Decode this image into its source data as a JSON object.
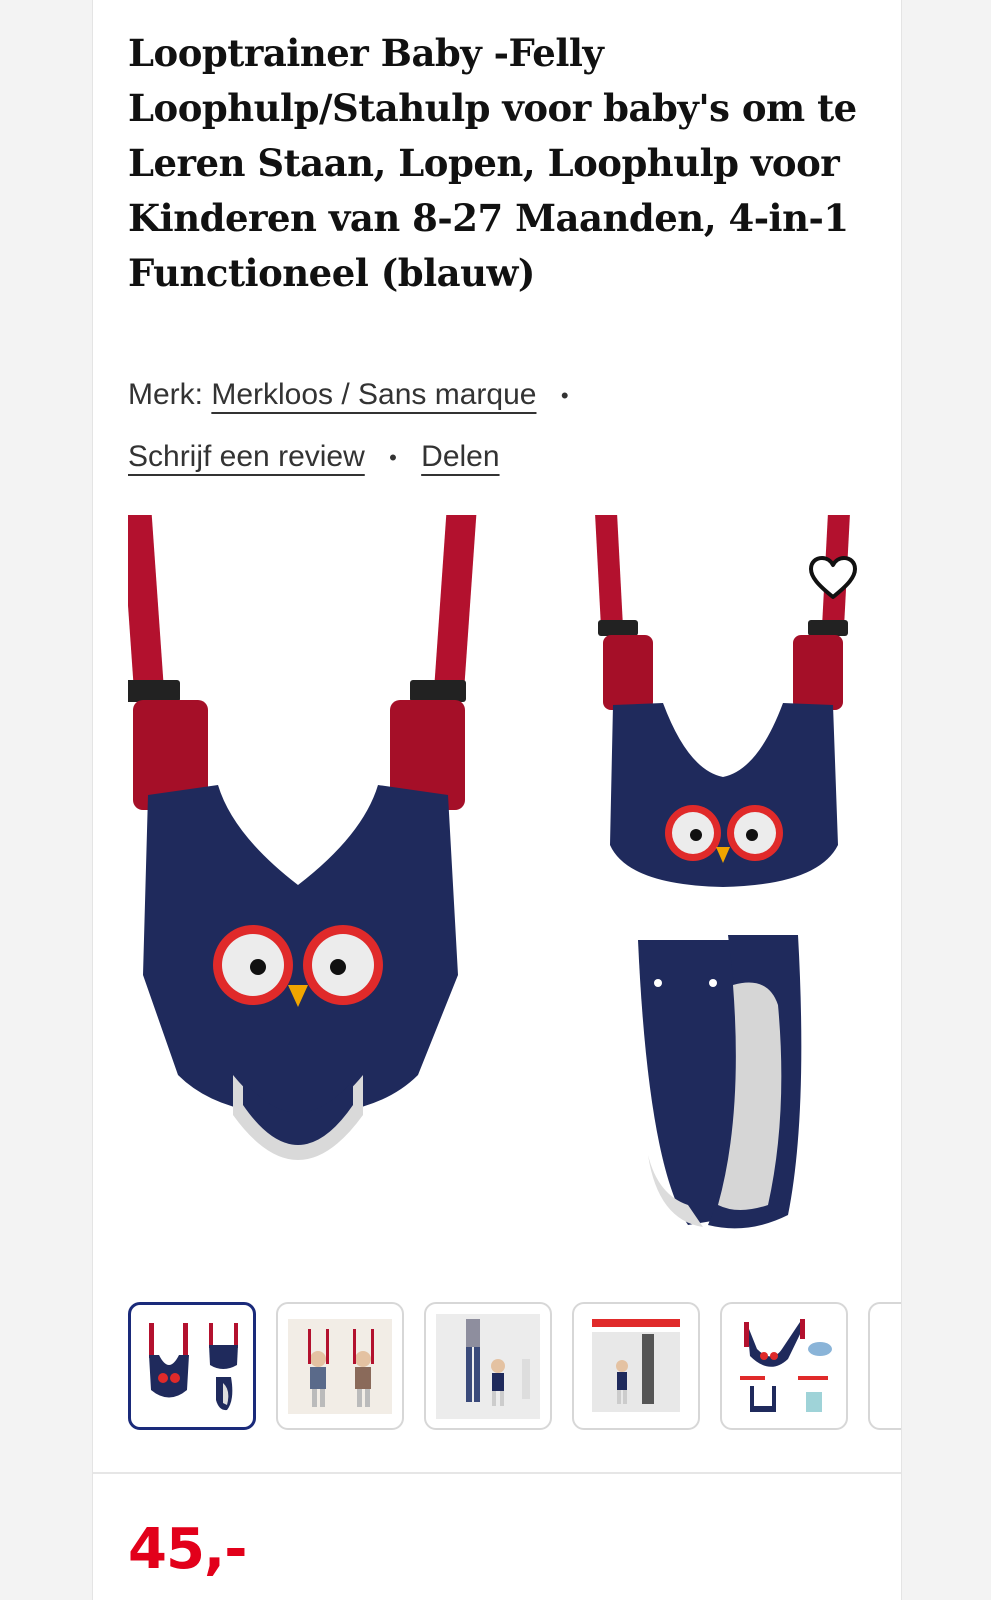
{
  "product": {
    "title": "Looptrainer Baby -Felly Loophulp/Stahulp voor baby's om te Leren Staan, Lopen, Loophulp voor Kinderen van 8-27 Maanden, 4-in-1 Functioneel (blauw)",
    "brand_label": "Merk:",
    "brand_value": "Merkloos / Sans marque",
    "write_review": "Schrijf een review",
    "share": "Delen",
    "separator": "•",
    "price": "45,-"
  },
  "gallery": {
    "main_image": "baby-walking-harness-owl",
    "favorite_icon": "heart-icon",
    "thumbnails": [
      {
        "name": "thumb-harness-front-and-side",
        "active": true
      },
      {
        "name": "thumb-babies-wearing-harness",
        "active": false
      },
      {
        "name": "thumb-parent-walking-baby",
        "active": false
      },
      {
        "name": "thumb-parent-with-baby-banner",
        "active": false
      },
      {
        "name": "thumb-harness-parts-overview",
        "active": false
      }
    ]
  },
  "colors": {
    "navy": "#1f2a5c",
    "red": "#b3112e",
    "price_red": "#e2001a",
    "active_border": "#1a2a7a"
  }
}
